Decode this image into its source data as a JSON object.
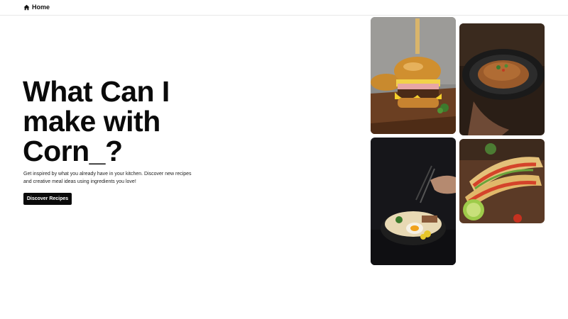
{
  "nav": {
    "home_label": "Home",
    "home_icon": "home-icon"
  },
  "hero": {
    "title_lines": [
      "What Can I",
      "make with",
      "Corn_?"
    ],
    "description_lines": [
      "Get inspired by what you already have in your kitchen. Discover new recipes",
      "and creative meal ideas using ingredients you love!"
    ],
    "cta_label": "Discover Recipes"
  },
  "gallery": {
    "images": [
      "burger-photo",
      "noodles-photo",
      "ramen-photo",
      "tacos-photo"
    ]
  },
  "colors": {
    "text": "#0a0a0a",
    "button_bg": "#0a0a0a",
    "button_text": "#ffffff",
    "background": "#ffffff"
  }
}
